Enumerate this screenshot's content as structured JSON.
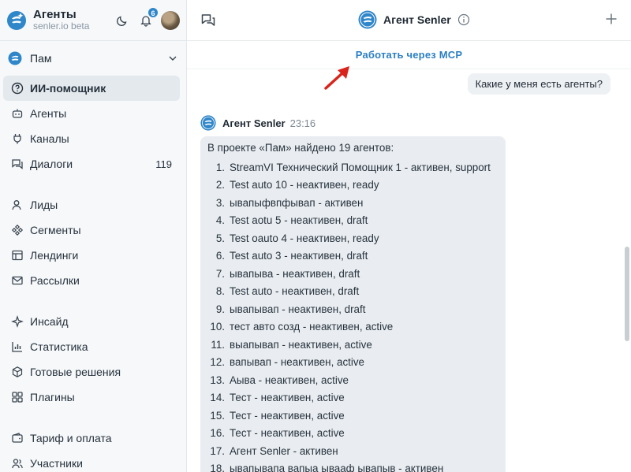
{
  "sidebar": {
    "brand_title": "Агенты",
    "brand_subtitle": "senler.io beta",
    "notifications_count": "6",
    "project_name": "Пам",
    "nav_group1": [
      {
        "label": "ИИ-помощник",
        "icon": "help-circle-icon",
        "active": true
      },
      {
        "label": "Агенты",
        "icon": "robot-icon"
      },
      {
        "label": "Каналы",
        "icon": "plug-icon"
      },
      {
        "label": "Диалоги",
        "icon": "chat-icon",
        "count": "119"
      }
    ],
    "nav_group2": [
      {
        "label": "Лиды",
        "icon": "user-icon"
      },
      {
        "label": "Сегменты",
        "icon": "segments-icon"
      },
      {
        "label": "Лендинги",
        "icon": "layout-icon"
      },
      {
        "label": "Рассылки",
        "icon": "mail-icon"
      }
    ],
    "nav_group3": [
      {
        "label": "Инсайд",
        "icon": "sparkle-icon"
      },
      {
        "label": "Статистика",
        "icon": "bar-chart-icon"
      },
      {
        "label": "Готовые решения",
        "icon": "box-icon"
      },
      {
        "label": "Плагины",
        "icon": "puzzle-icon"
      }
    ],
    "nav_group4": [
      {
        "label": "Тариф и оплата",
        "icon": "wallet-icon"
      },
      {
        "label": "Участники",
        "icon": "people-icon"
      }
    ]
  },
  "header": {
    "agent_title": "Агент Senler"
  },
  "mcp_link": "Работать через MCP",
  "chat": {
    "user_message": "Какие у меня есть агенты?",
    "agent_name": "Агент Senler",
    "agent_time": "23:16",
    "intro": "В проекте «Пам» найдено 19 агентов:",
    "items": [
      {
        "num": "1.",
        "text": "StreamVI Технический Помощник 1 - активен, support"
      },
      {
        "num": "2.",
        "text": "Test auto 10 - неактивен, ready"
      },
      {
        "num": "3.",
        "text": "ывапыфвпфывап - активен"
      },
      {
        "num": "4.",
        "text": "Test aotu 5 - неактивен, draft"
      },
      {
        "num": "5.",
        "text": "Test oauto 4 - неактивен, ready"
      },
      {
        "num": "6.",
        "text": "Test auto 3 - неактивен, draft"
      },
      {
        "num": "7.",
        "text": "ывапыва - неактивен, draft"
      },
      {
        "num": "8.",
        "text": "Test auto - неактивен, draft"
      },
      {
        "num": "9.",
        "text": "ывапывап - неактивен, draft"
      },
      {
        "num": "10.",
        "text": "тест авто созд - неактивен, active"
      },
      {
        "num": "11.",
        "text": "выапывап - неактивен, active"
      },
      {
        "num": "12.",
        "text": "вапывап - неактивен, active"
      },
      {
        "num": "13.",
        "text": "Аыва - неактивен, active"
      },
      {
        "num": "14.",
        "text": "Тест - неактивен, active"
      },
      {
        "num": "15.",
        "text": "Тест - неактивен, active"
      },
      {
        "num": "16.",
        "text": "Тест - неактивен, active"
      },
      {
        "num": "17.",
        "text": "Агент Senler - активен"
      },
      {
        "num": "18.",
        "text": "ывапывапа вапыа ывааф ывапыв - активен"
      }
    ]
  },
  "colors": {
    "accent": "#2c7fc4",
    "arrow": "#d9241b",
    "sidebar_bg": "#f6f8fa",
    "bubble_bg": "#e9edf1"
  }
}
